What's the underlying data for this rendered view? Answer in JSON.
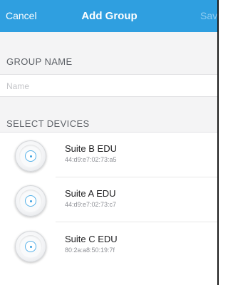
{
  "navbar": {
    "cancel_label": "Cancel",
    "title": "Add Group",
    "save_label": "Save",
    "background_color": "#2f9fe0",
    "save_color": "#8fcdf2"
  },
  "group_name": {
    "header": "GROUP NAME",
    "placeholder": "Name",
    "value": ""
  },
  "devices": {
    "header": "SELECT DEVICES",
    "icon": "access-point-icon",
    "items": [
      {
        "name": "Suite B EDU",
        "mac": "44:d9:e7:02:73:a5"
      },
      {
        "name": "Suite A EDU",
        "mac": "44:d9:e7:02:73:c7"
      },
      {
        "name": "Suite C EDU",
        "mac": "80:2a:a8:50:19:7f"
      }
    ]
  }
}
